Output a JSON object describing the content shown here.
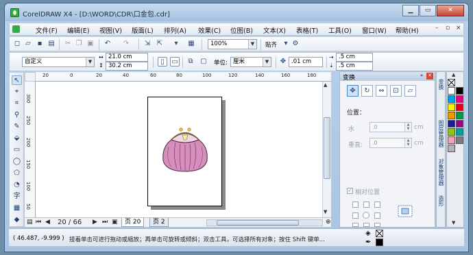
{
  "window": {
    "title": "CorelDRAW X4 - [D:\\WORD\\CDR\\口金包.cdr]"
  },
  "menu": [
    "文件(F)",
    "编辑(E)",
    "视图(V)",
    "版面(L)",
    "排列(A)",
    "效果(C)",
    "位图(B)",
    "文本(X)",
    "表格(T)",
    "工具(O)",
    "窗口(W)",
    "帮助(H)"
  ],
  "standard_toolbar": {
    "zoom": "100%",
    "snap_label": "贴齐"
  },
  "property_bar": {
    "paper_preset": "自定义",
    "width": "21.0 cm",
    "height": "30.2 cm",
    "units_label": "单位:",
    "units_value": "厘米",
    "nudge": ".01 cm",
    "dup_x": ".5 cm",
    "dup_y": ".5 cm"
  },
  "ruler_h": [
    "20",
    "0",
    "20",
    "40",
    "60",
    "80",
    "100",
    "120",
    "140",
    "160",
    "180",
    "200"
  ],
  "ruler_v": [
    "300",
    "250",
    "200",
    "150",
    "100",
    "50"
  ],
  "page_nav": {
    "counter": "20 / 66",
    "tabs": [
      "页 20",
      "页 2"
    ]
  },
  "docker": {
    "title": "变换",
    "position_label": "位置：",
    "h_label": "水",
    "h_value": ".0",
    "v_label": "垂直:",
    "v_value": ".0",
    "unit": "cm",
    "relative_label": "相对位置"
  },
  "side_tabs": [
    "变换",
    "图层管理器",
    "对象管理器",
    "造形"
  ],
  "palette_colors": [
    "#ffffff",
    "#000000",
    "#00a0e9",
    "#e4007f",
    "#fff100",
    "#e60012",
    "#f39800",
    "#009944",
    "#1d2088",
    "#920783",
    "#8fc31f",
    "#00a0a0",
    "#f5a2b8",
    "#7d7d7d",
    "#b5b5b5"
  ],
  "status": {
    "coords": "( 46.487, -9.999 )",
    "message": "接着单击可进行拖动或缩放；再单击可旋转或倾斜；双击工具，可选择所有对象；按住 Shift 键单..."
  }
}
